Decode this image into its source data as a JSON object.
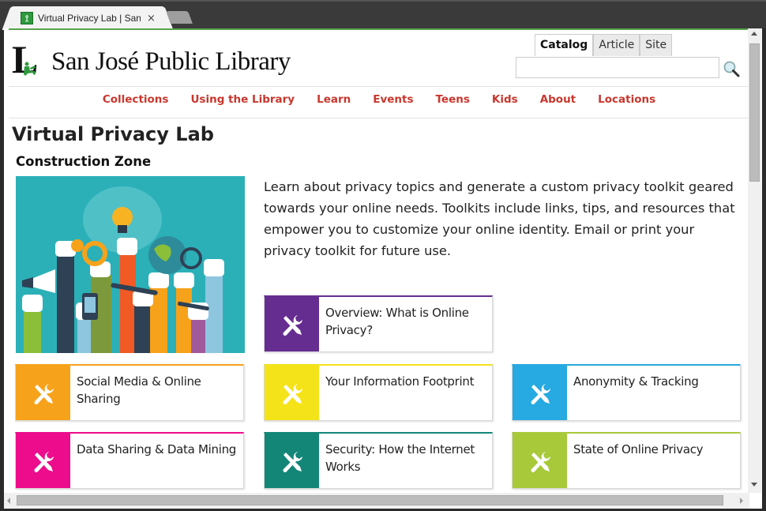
{
  "browser": {
    "tab_title": "Virtual Privacy Lab | San Jo",
    "tab_close": "×"
  },
  "header": {
    "logo_letter": "L",
    "logo_text": "San José Public Library",
    "search_tabs": [
      "Catalog",
      "Article",
      "Site"
    ],
    "search_active": "Catalog",
    "search_value": "",
    "search_placeholder": ""
  },
  "nav": {
    "items": [
      "Collections",
      "Using the Library",
      "Learn",
      "Events",
      "Teens",
      "Kids",
      "About",
      "Locations"
    ]
  },
  "main": {
    "title": "Virtual Privacy Lab",
    "subtitle": "Construction Zone",
    "intro": "Learn about privacy topics and generate a custom privacy toolkit geared towards your online needs. Toolkits include links, tips, and resources that empower you to customize your online identity. Email or print your privacy toolkit for future use.",
    "hero_image": "hands-holding-tech-illustration",
    "cards": [
      {
        "label": "Overview: What is Online Privacy?",
        "color": "#662d91",
        "icon": "tools-icon"
      },
      {
        "label": "Social Media & Online Sharing",
        "color": "#f7a21b",
        "icon": "tools-icon"
      },
      {
        "label": "Your Information Footprint",
        "color": "#f5e31a",
        "icon": "tools-icon"
      },
      {
        "label": "Anonymity & Tracking",
        "color": "#27a9e1",
        "icon": "tools-icon"
      },
      {
        "label": "Data Sharing & Data Mining",
        "color": "#ec0c8c",
        "icon": "tools-icon"
      },
      {
        "label": "Security: How the Internet Works",
        "color": "#138678",
        "icon": "tools-icon"
      },
      {
        "label": "State of Online Privacy",
        "color": "#a7c93a",
        "icon": "tools-icon"
      }
    ]
  },
  "colors": {
    "nav_link": "#c8372d",
    "accent_green": "#5aa34c",
    "hero_bg": "#2bb0b8"
  }
}
